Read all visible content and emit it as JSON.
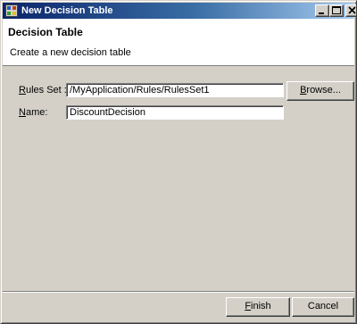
{
  "window": {
    "title": "New Decision Table",
    "icon": "wizard-app-icon",
    "controls": [
      "minimize-icon",
      "maximize-icon",
      "close-icon"
    ]
  },
  "header": {
    "title": "Decision Table",
    "description": "Create a new decision table"
  },
  "form": {
    "rules_set": {
      "label_mnemonic": "R",
      "label_rest": "ules Set :",
      "value": "/MyApplication/Rules/RulesSet1"
    },
    "browse_button": {
      "mnemonic": "B",
      "rest": "rowse..."
    },
    "name": {
      "label_mnemonic": "N",
      "label_rest": "ame:",
      "value": "DiscountDecision"
    }
  },
  "footer": {
    "finish": {
      "mnemonic": "F",
      "rest": "inish"
    },
    "cancel": {
      "label": "Cancel"
    }
  }
}
